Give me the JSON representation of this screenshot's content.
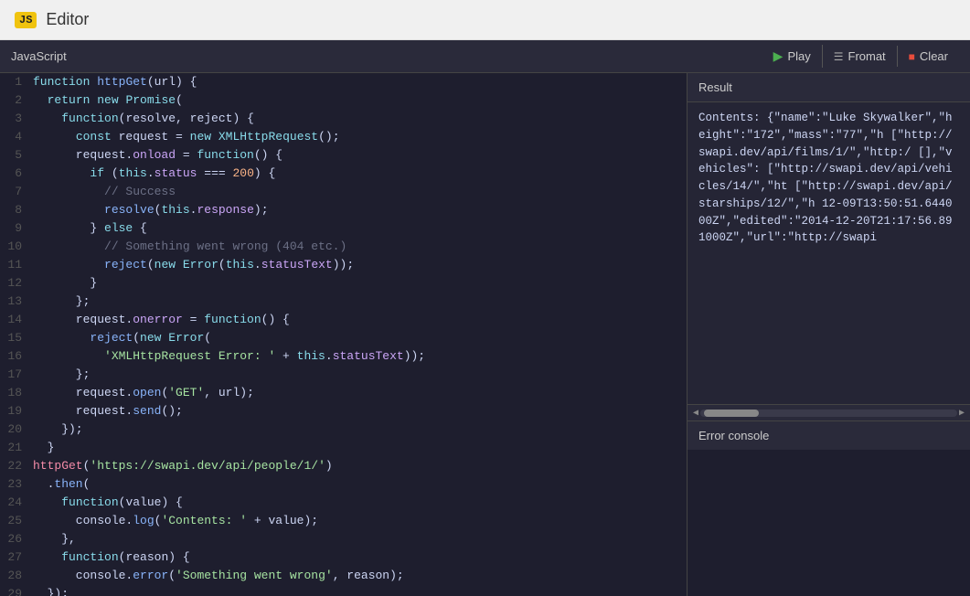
{
  "titlebar": {
    "badge": "JS",
    "title": "Editor"
  },
  "toolbar": {
    "language": "JavaScript",
    "play_label": "Play",
    "format_label": "Fromat",
    "clear_label": "Clear"
  },
  "result": {
    "header": "Result",
    "content": "Contents: {\"name\":\"Luke Skywalker\",\"height\":\"172\",\"mass\":\"77\",\"h [\"http://swapi.dev/api/films/1/\",\"http:/ [],\"vehicles\": [\"http://swapi.dev/api/vehicles/14/\",\"ht [\"http://swapi.dev/api/starships/12/\",\"h 12-09T13:50:51.644000Z\",\"edited\":\"2014-12-20T21:17:56.891000Z\",\"url\":\"http://swapi"
  },
  "error_console": {
    "header": "Error console"
  },
  "code": {
    "lines": [
      {
        "num": "1",
        "html": "<span class='kw'>function</span> <span class='fn'>httpGet</span>(url) {"
      },
      {
        "num": "2",
        "html": "  <span class='kw'>return</span> <span class='kw'>new</span> <span class='obj'>Promise</span>("
      },
      {
        "num": "3",
        "html": "    <span class='kw'>function</span>(resolve, reject) {"
      },
      {
        "num": "4",
        "html": "      <span class='kw'>const</span> request = <span class='kw'>new</span> <span class='obj'>XMLHttpRequest</span>();"
      },
      {
        "num": "5",
        "html": "      request.<span class='prop'>onload</span> = <span class='kw'>function</span>() {"
      },
      {
        "num": "6",
        "html": "        <span class='kw'>if</span> (<span class='kw'>this</span>.<span class='prop'>status</span> === <span class='num'>200</span>) {"
      },
      {
        "num": "7",
        "html": "          <span class='cmt'>// Success</span>"
      },
      {
        "num": "8",
        "html": "          <span class='fn'>resolve</span>(<span class='kw'>this</span>.<span class='prop'>response</span>);"
      },
      {
        "num": "9",
        "html": "        } <span class='kw'>else</span> {"
      },
      {
        "num": "10",
        "html": "          <span class='cmt'>// Something went wrong (404 etc.)</span>"
      },
      {
        "num": "11",
        "html": "          <span class='fn'>reject</span>(<span class='kw'>new</span> <span class='obj'>Error</span>(<span class='kw'>this</span>.<span class='prop'>statusText</span>));"
      },
      {
        "num": "12",
        "html": "        }"
      },
      {
        "num": "13",
        "html": "      };"
      },
      {
        "num": "14",
        "html": "      request.<span class='prop'>onerror</span> = <span class='kw'>function</span>() {"
      },
      {
        "num": "15",
        "html": "        <span class='fn'>reject</span>(<span class='kw'>new</span> <span class='obj'>Error</span>("
      },
      {
        "num": "16",
        "html": "          <span class='str'>'XMLHttpRequest Error: '</span> + <span class='kw'>this</span>.<span class='prop'>statusText</span>));"
      },
      {
        "num": "17",
        "html": "      };"
      },
      {
        "num": "18",
        "html": "      request.<span class='method'>open</span>(<span class='str'>'GET'</span>, url);"
      },
      {
        "num": "19",
        "html": "      request.<span class='method'>send</span>();"
      },
      {
        "num": "20",
        "html": "    });"
      },
      {
        "num": "21",
        "html": "  }"
      },
      {
        "num": "22",
        "html": "<span class='red'>httpGet</span>(<span class='str'>'https://swapi.dev/api/people/1/'</span>)"
      },
      {
        "num": "23",
        "html": "  .<span class='method'>then</span>("
      },
      {
        "num": "24",
        "html": "    <span class='kw'>function</span>(value) {"
      },
      {
        "num": "25",
        "html": "      console.<span class='method'>log</span>(<span class='str'>'Contents: '</span> + value);"
      },
      {
        "num": "26",
        "html": "    },"
      },
      {
        "num": "27",
        "html": "    <span class='kw'>function</span>(reason) {"
      },
      {
        "num": "28",
        "html": "      console.<span class='method'>error</span>(<span class='str'>'Something went wrong'</span>, reason);"
      },
      {
        "num": "29",
        "html": "  });"
      }
    ]
  }
}
